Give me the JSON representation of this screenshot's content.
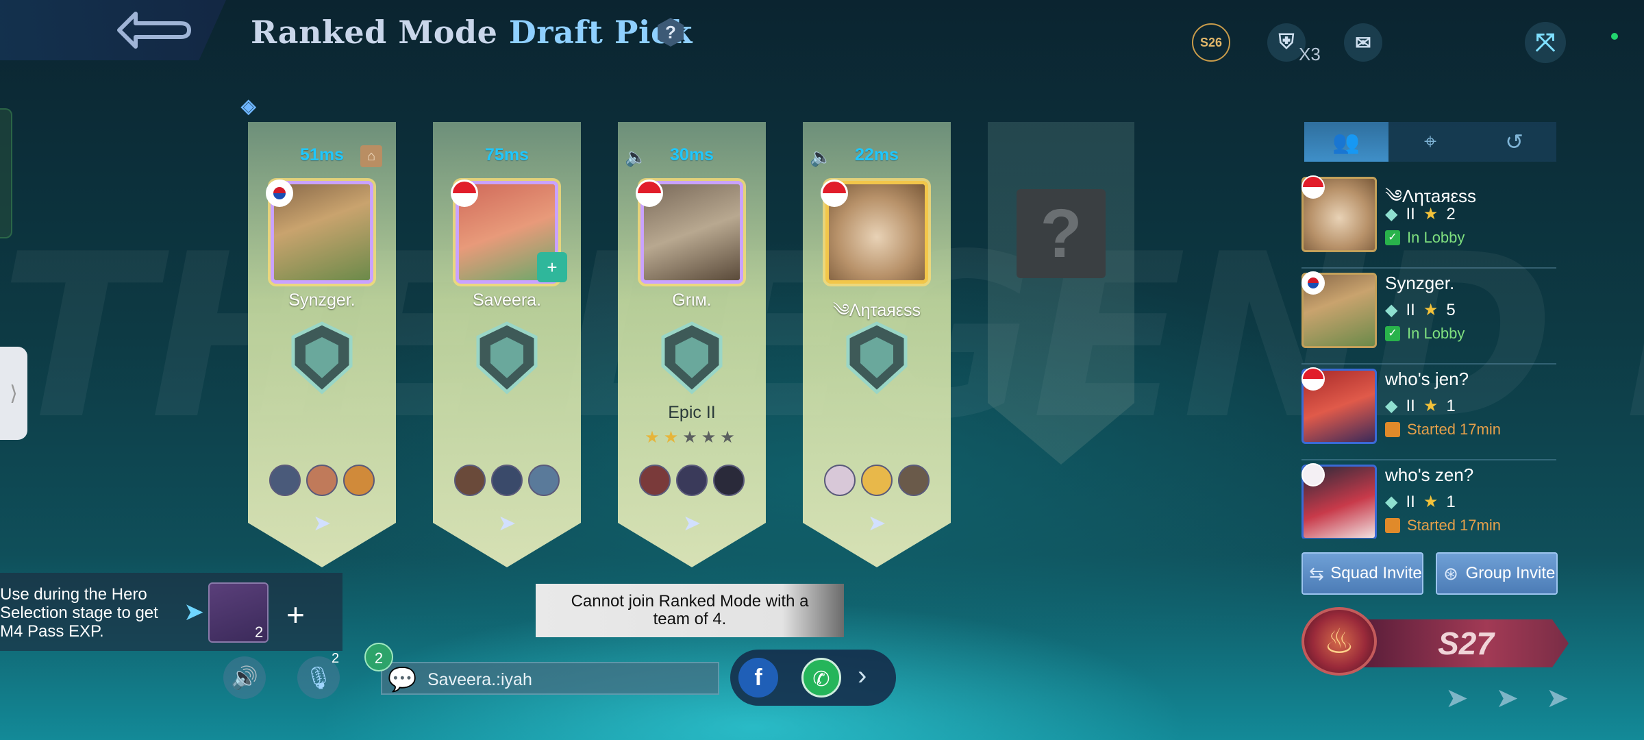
{
  "header": {
    "title_part1": "Ranked Mode",
    "title_part2": "Draft Pick",
    "help": "?",
    "season_badge": "S26",
    "shield_count": "X3"
  },
  "players": [
    {
      "ping": "51ms",
      "name": "Synzger.",
      "flag": "kr",
      "rank_text": "",
      "stars_on": 0,
      "stars_total": 0,
      "has_home_badge": true,
      "has_speaker": false,
      "has_add_friend": false
    },
    {
      "ping": "75ms",
      "name": "Saveera.",
      "flag": "id",
      "rank_text": "",
      "stars_on": 0,
      "stars_total": 0,
      "has_home_badge": false,
      "has_speaker": false,
      "has_add_friend": true
    },
    {
      "ping": "30ms",
      "name": "Grιм.",
      "flag": "id",
      "rank_text": "Epic II",
      "stars_on": 2,
      "stars_total": 5,
      "has_home_badge": false,
      "has_speaker": true,
      "has_add_friend": false
    },
    {
      "ping": "22ms",
      "name": "༄Λητaяεss",
      "flag": "id",
      "rank_text": "",
      "stars_on": 0,
      "stars_total": 0,
      "has_home_badge": false,
      "has_speaker": true,
      "has_add_friend": false
    }
  ],
  "empty_slot": "?",
  "friend_tabs": [
    "friends-icon",
    "location-icon",
    "history-icon"
  ],
  "friends": [
    {
      "name": "༄Λητaяεss",
      "tier": "II",
      "stars": "2",
      "status": "In Lobby",
      "status_type": "lobby"
    },
    {
      "name": "Synzger.",
      "tier": "II",
      "stars": "5",
      "status": "In Lobby",
      "status_type": "lobby"
    },
    {
      "name": "who's jen?",
      "tier": "II",
      "stars": "1",
      "status": "Started 17min",
      "status_type": "game"
    },
    {
      "name": "who's zen?",
      "tier": "II",
      "stars": "1",
      "status": "Started 17min",
      "status_type": "game"
    }
  ],
  "invite": {
    "squad": "Squad Invite",
    "group": "Group Invite"
  },
  "season_banner": "S27",
  "exp_panel": {
    "text": "Use during the Hero Selection stage to get M4 Pass EXP.",
    "item_count": "2",
    "add": "+"
  },
  "voice": {
    "mic_count": "2"
  },
  "chat": {
    "unread": "2",
    "message": "Saveera.:iyah"
  },
  "toast": "Cannot join Ranked Mode with a team of 4.",
  "colors": {
    "ping": "#1ec7ff",
    "title_accent": "#8fd0ff",
    "lobby_status": "#7fe07f",
    "game_status": "#e6a04a"
  }
}
